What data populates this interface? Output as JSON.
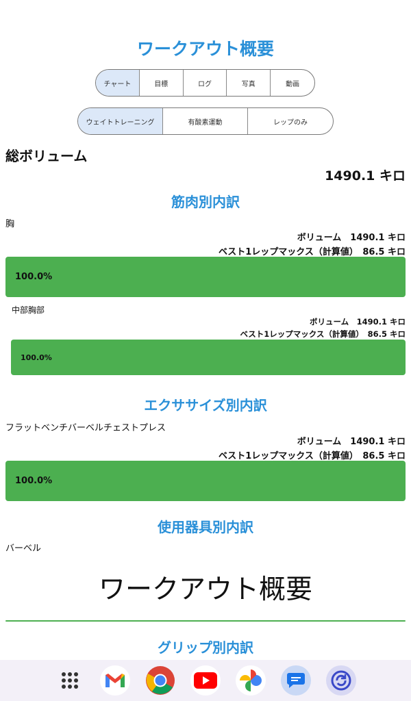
{
  "title": "ワークアウト概要",
  "tabs": [
    "チャート",
    "目標",
    "ログ",
    "写真",
    "動画"
  ],
  "types": [
    "ウェイトトレーニング",
    "有酸素運動",
    "レップのみ"
  ],
  "total": {
    "heading": "総ボリューム",
    "value": "1490.1 キロ"
  },
  "muscle_section": {
    "title": "筋肉別内訳",
    "group": {
      "name": "胸",
      "volume": "ボリューム　1490.1 キロ",
      "orm": "ベスト1レップマックス（計算値）　86.5 キロ",
      "percent": "100.0%"
    },
    "sub": {
      "name": "中部胸部",
      "volume": "ボリューム　1490.1 キロ",
      "orm": "ベスト1レップマックス（計算値）　86.5 キロ",
      "percent": "100.0%"
    }
  },
  "exercise_section": {
    "title": "エクササイズ別内訳",
    "name": "フラットベンチバーベルチェストプレス",
    "volume": "ボリューム　1490.1 キロ",
    "orm": "ベスト1レップマックス（計算値）　86.5 キロ",
    "percent": "100.0%"
  },
  "equipment_section": {
    "title": "使用器具別内訳",
    "name": "バーベル"
  },
  "overlay_title": "ワークアウト概要",
  "grip_section": {
    "title": "グリップ別内訳"
  },
  "dock": [
    "apps-grid-icon",
    "gmail-icon",
    "chrome-icon",
    "youtube-icon",
    "photos-icon",
    "messages-icon",
    "sync-icon"
  ]
}
